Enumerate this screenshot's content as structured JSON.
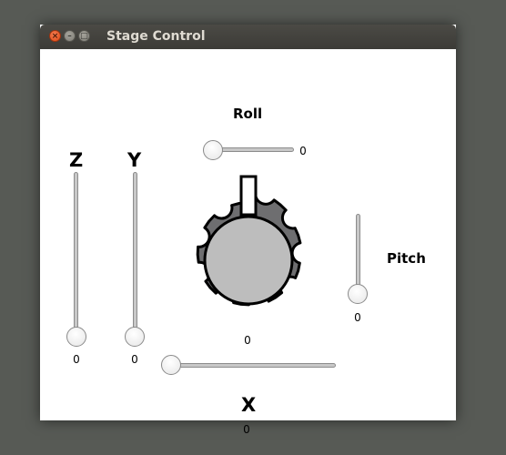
{
  "window": {
    "title": "Stage Control"
  },
  "roll": {
    "label": "Roll",
    "value": "0"
  },
  "z": {
    "label": "Z",
    "value": "0"
  },
  "y": {
    "label": "Y",
    "value": "0"
  },
  "pitch": {
    "label": "Pitch",
    "value": "0"
  },
  "dial": {
    "value": "0"
  },
  "x": {
    "label": "X",
    "value": "0"
  },
  "icons": {
    "close": "close-icon",
    "minimize": "minimize-icon",
    "maximize": "maximize-icon"
  }
}
